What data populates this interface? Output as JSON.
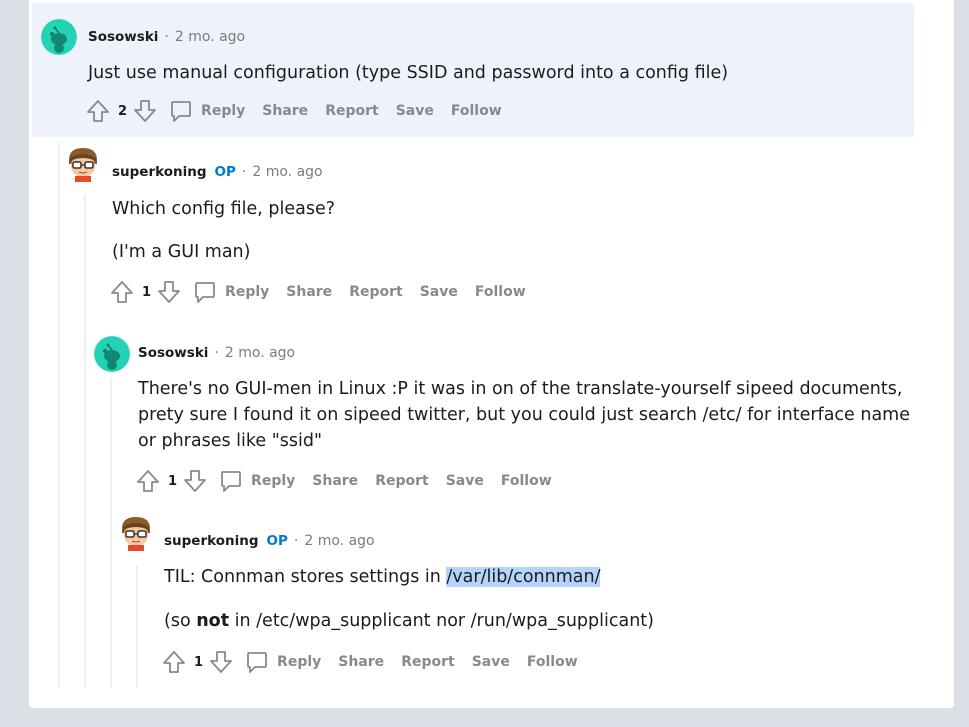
{
  "comments": [
    {
      "author": "Sosowski",
      "op_badge": "",
      "separator": "·",
      "time": "2 mo. ago",
      "avatar": "snoo-green-avatar",
      "paragraphs": [
        "Just use manual configuration (type SSID and password into a config file)"
      ],
      "votes": "2"
    },
    {
      "author": "superkoning",
      "op_badge": "OP",
      "separator": "·",
      "time": "2 mo. ago",
      "avatar": "glasses-character-avatar",
      "paragraphs": [
        "Which config file, please?",
        "(I'm a GUI man)"
      ],
      "votes": "1"
    },
    {
      "author": "Sosowski",
      "op_badge": "",
      "separator": "·",
      "time": "2 mo. ago",
      "avatar": "snoo-green-avatar",
      "paragraphs": [
        "There's no GUI-men in Linux :P it was in on of the translate-yourself sipeed documents, prety sure I found it on sipeed twitter, but you could just search /etc/ for interface name or phrases like \"ssid\""
      ],
      "votes": "1"
    },
    {
      "author": "superkoning",
      "op_badge": "OP",
      "separator": "·",
      "time": "2 mo. ago",
      "avatar": "glasses-character-avatar",
      "p1_prefix": "TIL: Connman stores settings in ",
      "p1_selected": "/var/lib/connman/",
      "p2_prefix": "(so ",
      "p2_bold": "not",
      "p2_suffix": " in /etc/wpa_supplicant nor /run/wpa_supplicant)",
      "votes": "1"
    }
  ],
  "actions": {
    "reply": "Reply",
    "share": "Share",
    "report": "Report",
    "save": "Save",
    "follow": "Follow"
  },
  "icons": {
    "upvote": "upvote-arrow-icon",
    "downvote": "downvote-arrow-icon",
    "reply": "comment-bubble-icon"
  },
  "colors": {
    "background": "#dae0e6",
    "highlight": "#eef3fb",
    "op": "#0079d3",
    "muted": "#7c7c7c",
    "action": "#878a8c",
    "snoo": "#24d3b5",
    "selection": "#b3d4fc"
  }
}
